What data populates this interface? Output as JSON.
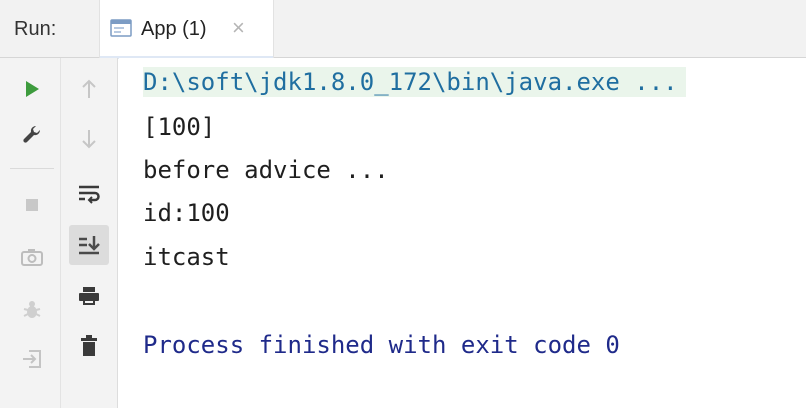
{
  "run_panel": {
    "label": "Run:",
    "tab": {
      "title": "App (1)",
      "close_glyph": "×",
      "icon": "console-window-icon"
    }
  },
  "toolbar": {
    "left_buttons": [
      "run-icon",
      "wrench-icon",
      "stop-icon",
      "camera-icon",
      "bug-icon",
      "login-icon"
    ],
    "right_buttons": [
      "up-arrow-icon",
      "down-arrow-icon",
      "soft-wrap-icon",
      "scroll-to-end-icon",
      "print-icon",
      "trash-icon"
    ]
  },
  "console": {
    "command": "D:\\soft\\jdk1.8.0_172\\bin\\java.exe ...",
    "output": [
      "[100]",
      "before advice ...",
      "id:100",
      "itcast"
    ],
    "exit_message": "Process finished with exit code 0"
  },
  "colors": {
    "run_green": "#3d9b3d",
    "command_text": "#1f6ea0",
    "command_highlight": "#eaf5eb",
    "exit_text": "#1f2a8a",
    "toolbar_bg": "#f3f3f3"
  }
}
